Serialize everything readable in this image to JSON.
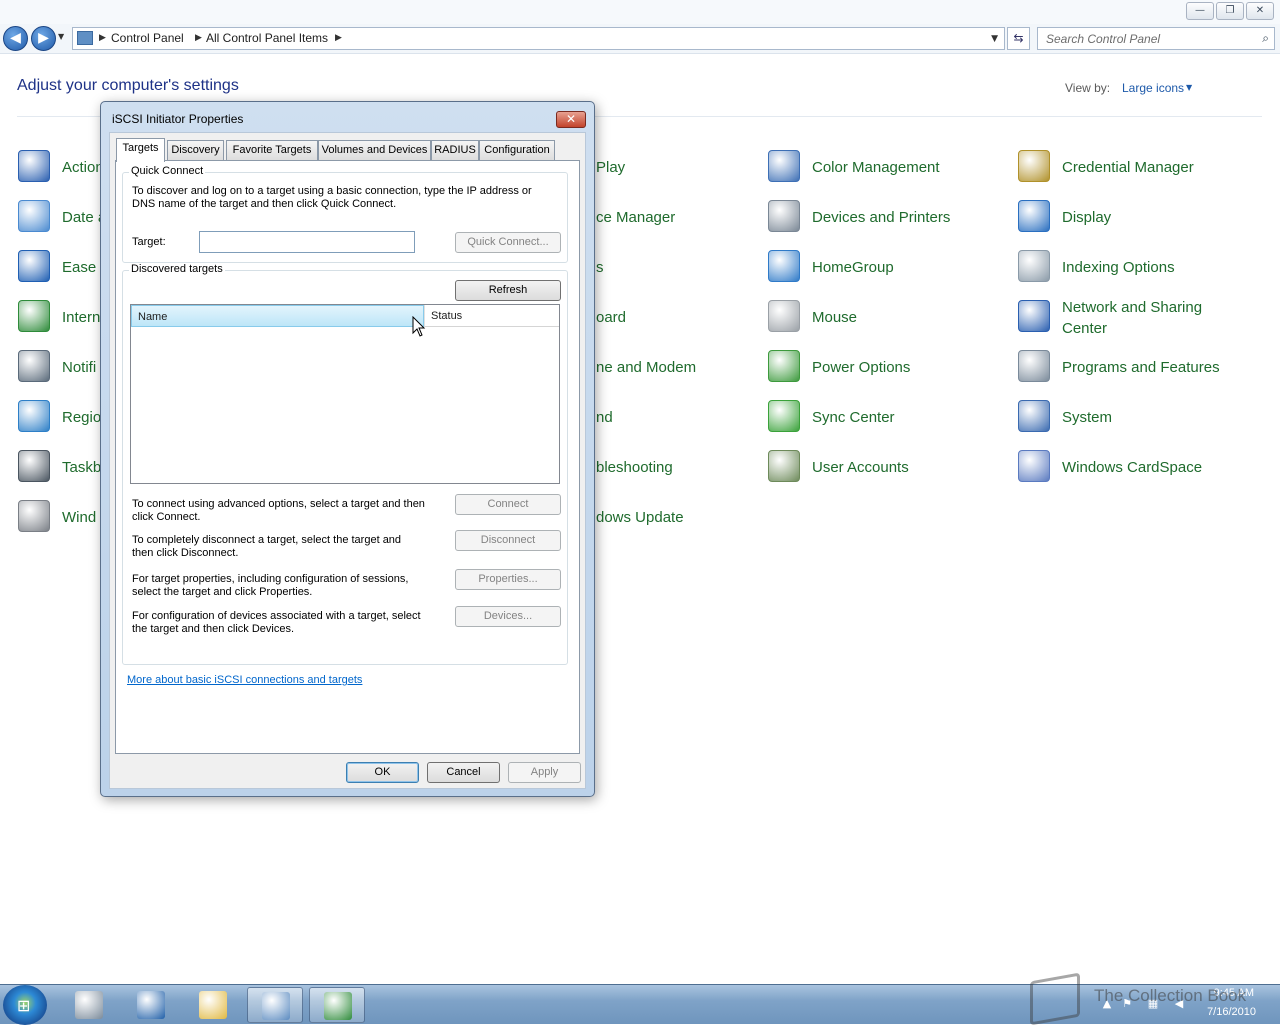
{
  "window": {
    "caption_buttons": [
      "—",
      "❐",
      "✕"
    ]
  },
  "address": {
    "crumbs": [
      "Control Panel",
      "All Control Panel Items"
    ],
    "search_placeholder": "Search Control Panel"
  },
  "page": {
    "heading": "Adjust your computer's settings",
    "view_by_label": "View by:",
    "view_by_value": "Large icons"
  },
  "items": [
    {
      "label": "Action Center",
      "visible": "Action",
      "icon": "action-center-flag-icon",
      "color": "#2a5fb0"
    },
    {
      "label": "Date and Time",
      "visible": "Date a",
      "icon": "calendar-clock-icon",
      "color": "#4a8ad0"
    },
    {
      "label": "Ease of Access Center",
      "visible": "Ease c",
      "icon": "ease-of-access-icon",
      "color": "#1f5fb3"
    },
    {
      "label": "Internet Options",
      "visible": "Intern",
      "icon": "internet-options-icon",
      "color": "#2e8b3a"
    },
    {
      "label": "Notification Area Icons",
      "visible": "Notifi",
      "icon": "notification-area-icon",
      "color": "#5a6a7a"
    },
    {
      "label": "Region and Language",
      "visible": "Regio",
      "icon": "region-globe-icon",
      "color": "#2d7fc7"
    },
    {
      "label": "Taskbar and Start Menu",
      "visible": "Taskb",
      "icon": "taskbar-icon",
      "color": "#4a5560"
    },
    {
      "label": "Windows Firewall",
      "visible": "Wind",
      "icon": "firewall-icon",
      "color": "#7a7f86"
    },
    {
      "label": "AutoPlay",
      "visible": "Play",
      "icon": "autoplay-icon",
      "color": "#3a7a3a"
    },
    {
      "label": "Device Manager",
      "visible": "ce Manager",
      "icon": "device-manager-icon",
      "color": "#666"
    },
    {
      "label": "Fonts",
      "visible": "s",
      "icon": "fonts-icon",
      "color": "#666"
    },
    {
      "label": "Keyboard",
      "visible": "oard",
      "icon": "keyboard-icon",
      "color": "#666"
    },
    {
      "label": "Phone and Modem",
      "visible": "ne and Modem",
      "icon": "phone-modem-icon",
      "color": "#666"
    },
    {
      "label": "Sound",
      "visible": "nd",
      "icon": "sound-icon",
      "color": "#666"
    },
    {
      "label": "Troubleshooting",
      "visible": "bleshooting",
      "icon": "troubleshooting-icon",
      "color": "#666"
    },
    {
      "label": "Windows Update",
      "visible": "dows Update",
      "icon": "windows-update-icon",
      "color": "#666"
    },
    {
      "label": "Color Management",
      "icon": "color-management-icon",
      "color": "#3d6fb5"
    },
    {
      "label": "Devices and Printers",
      "icon": "devices-printers-icon",
      "color": "#7a8795"
    },
    {
      "label": "HomeGroup",
      "icon": "homegroup-icon",
      "color": "#2f7ac8"
    },
    {
      "label": "Mouse",
      "icon": "mouse-icon",
      "color": "#9aa0a6"
    },
    {
      "label": "Power Options",
      "icon": "power-options-icon",
      "color": "#3d9a3d"
    },
    {
      "label": "Sync Center",
      "icon": "sync-center-icon",
      "color": "#3aa23a"
    },
    {
      "label": "User Accounts",
      "icon": "user-accounts-icon",
      "color": "#6d8a5a"
    },
    {
      "label": "Credential Manager",
      "icon": "credential-manager-icon",
      "color": "#b0912a"
    },
    {
      "label": "Display",
      "icon": "display-icon",
      "color": "#2a6fc0"
    },
    {
      "label": "Indexing Options",
      "icon": "indexing-options-icon",
      "color": "#8a9aa8"
    },
    {
      "label": "Network and Sharing Center",
      "icon": "network-sharing-icon",
      "color": "#2a5fb0"
    },
    {
      "label": "Programs and Features",
      "icon": "programs-features-icon",
      "color": "#7a8a9a"
    },
    {
      "label": "System",
      "icon": "system-icon",
      "color": "#3a6ab0"
    },
    {
      "label": "Windows CardSpace",
      "icon": "cardspace-icon",
      "color": "#5a7ac0"
    }
  ],
  "dialog": {
    "title": "iSCSI Initiator Properties",
    "tabs": [
      "Targets",
      "Discovery",
      "Favorite Targets",
      "Volumes and Devices",
      "RADIUS",
      "Configuration"
    ],
    "quick_connect": {
      "group_label": "Quick Connect",
      "description": "To discover and log on to a target using a basic connection, type the IP address or DNS name of the target and then click Quick Connect.",
      "target_label": "Target:",
      "target_value": "",
      "button": "Quick Connect..."
    },
    "discovered": {
      "group_label": "Discovered targets",
      "refresh": "Refresh",
      "col_name": "Name",
      "col_status": "Status",
      "rows": []
    },
    "actions": [
      {
        "text": "To connect using advanced options, select a target and then click Connect.",
        "button": "Connect"
      },
      {
        "text": "To completely disconnect a target, select the target and then click Disconnect.",
        "button": "Disconnect"
      },
      {
        "text": "For target properties, including configuration of sessions, select the target and click Properties.",
        "button": "Properties..."
      },
      {
        "text": "For configuration of devices associated with a target, select the target and then click Devices.",
        "button": "Devices..."
      }
    ],
    "link": "More about basic iSCSI connections and targets",
    "ok": "OK",
    "cancel": "Cancel",
    "apply": "Apply"
  },
  "taskbar": {
    "time": "9:45 AM",
    "date": "7/16/2010",
    "watermark": "The Collection Book",
    "pinned": [
      {
        "icon": "server-manager-icon",
        "color": "#7a8a9a",
        "active": false
      },
      {
        "icon": "powershell-icon",
        "color": "#1f5fa8",
        "active": false
      },
      {
        "icon": "explorer-folder-icon",
        "color": "#e0b840",
        "active": false
      },
      {
        "icon": "control-panel-icon",
        "color": "#5a8ac0",
        "active": true
      },
      {
        "icon": "iscsi-globe-icon",
        "color": "#2e8b3a",
        "active": true
      }
    ]
  }
}
